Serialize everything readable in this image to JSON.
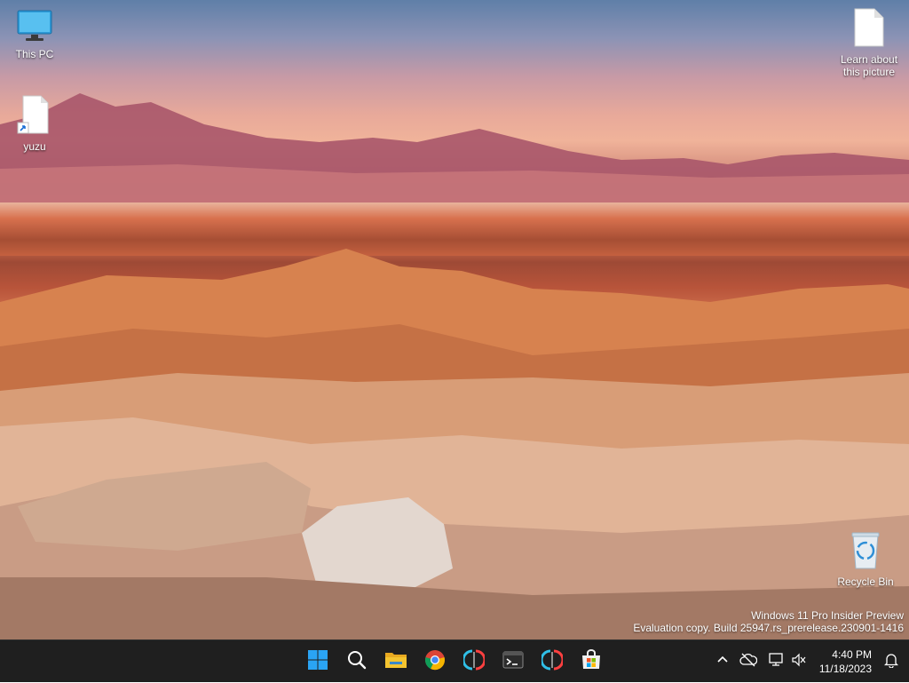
{
  "desktop": {
    "icons": [
      {
        "label": "This PC",
        "icon": "monitor-icon"
      },
      {
        "label": "yuzu",
        "icon": "shortcut-file-icon"
      },
      {
        "label": "Learn about this picture",
        "icon": "file-icon"
      },
      {
        "label": "Recycle Bin",
        "icon": "recycle-bin-icon"
      }
    ],
    "watermark": {
      "line1": "Windows 11 Pro Insider Preview",
      "line2": "Evaluation copy. Build 25947.rs_prerelease.230901-1416"
    }
  },
  "taskbar": {
    "apps": [
      {
        "name": "Start",
        "icon": "windows-logo-icon"
      },
      {
        "name": "Search",
        "icon": "search-icon"
      },
      {
        "name": "File Explorer",
        "icon": "folder-icon"
      },
      {
        "name": "Google Chrome",
        "icon": "chrome-icon"
      },
      {
        "name": "yuzu",
        "icon": "yuzu-icon"
      },
      {
        "name": "Terminal",
        "icon": "terminal-icon"
      },
      {
        "name": "yuzu",
        "icon": "yuzu-icon"
      },
      {
        "name": "Microsoft Store",
        "icon": "store-icon"
      }
    ],
    "tray": {
      "time": "4:40 PM",
      "date": "11/18/2023"
    }
  },
  "colors": {
    "taskbar_bg": "#1f1f1f",
    "folder_yellow": "#f4c430",
    "start_blue": "#2aa4f4"
  }
}
